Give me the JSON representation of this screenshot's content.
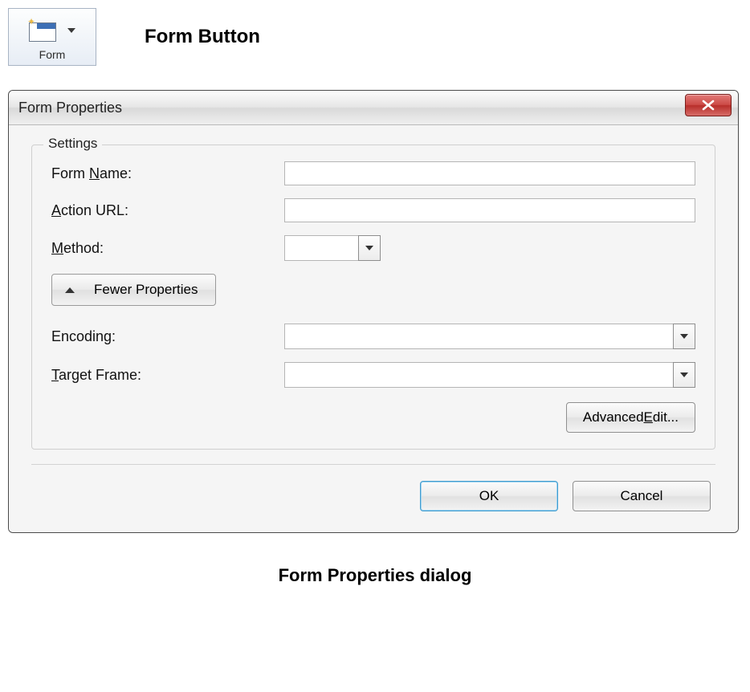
{
  "toolbar": {
    "form_button_label": "Form"
  },
  "headings": {
    "top": "Form Button",
    "bottom": "Form Properties dialog"
  },
  "dialog": {
    "title": "Form Properties",
    "group_legend": "Settings",
    "labels": {
      "form_name_pre": "Form ",
      "form_name_ul": "N",
      "form_name_post": "ame:",
      "action_ul": "A",
      "action_post": "ction URL:",
      "method_ul": "M",
      "method_post": "ethod:",
      "encoding": "Encoding:",
      "target_ul": "T",
      "target_post": "arget Frame:"
    },
    "values": {
      "form_name": "",
      "action_url": "",
      "method": "",
      "encoding": "",
      "target_frame": ""
    },
    "fewer_pre": "Fewer ",
    "fewer_ul": "P",
    "fewer_post": "roperties",
    "advanced_pre": "Advanced ",
    "advanced_ul": "E",
    "advanced_post": "dit...",
    "ok": "OK",
    "cancel": "Cancel"
  }
}
